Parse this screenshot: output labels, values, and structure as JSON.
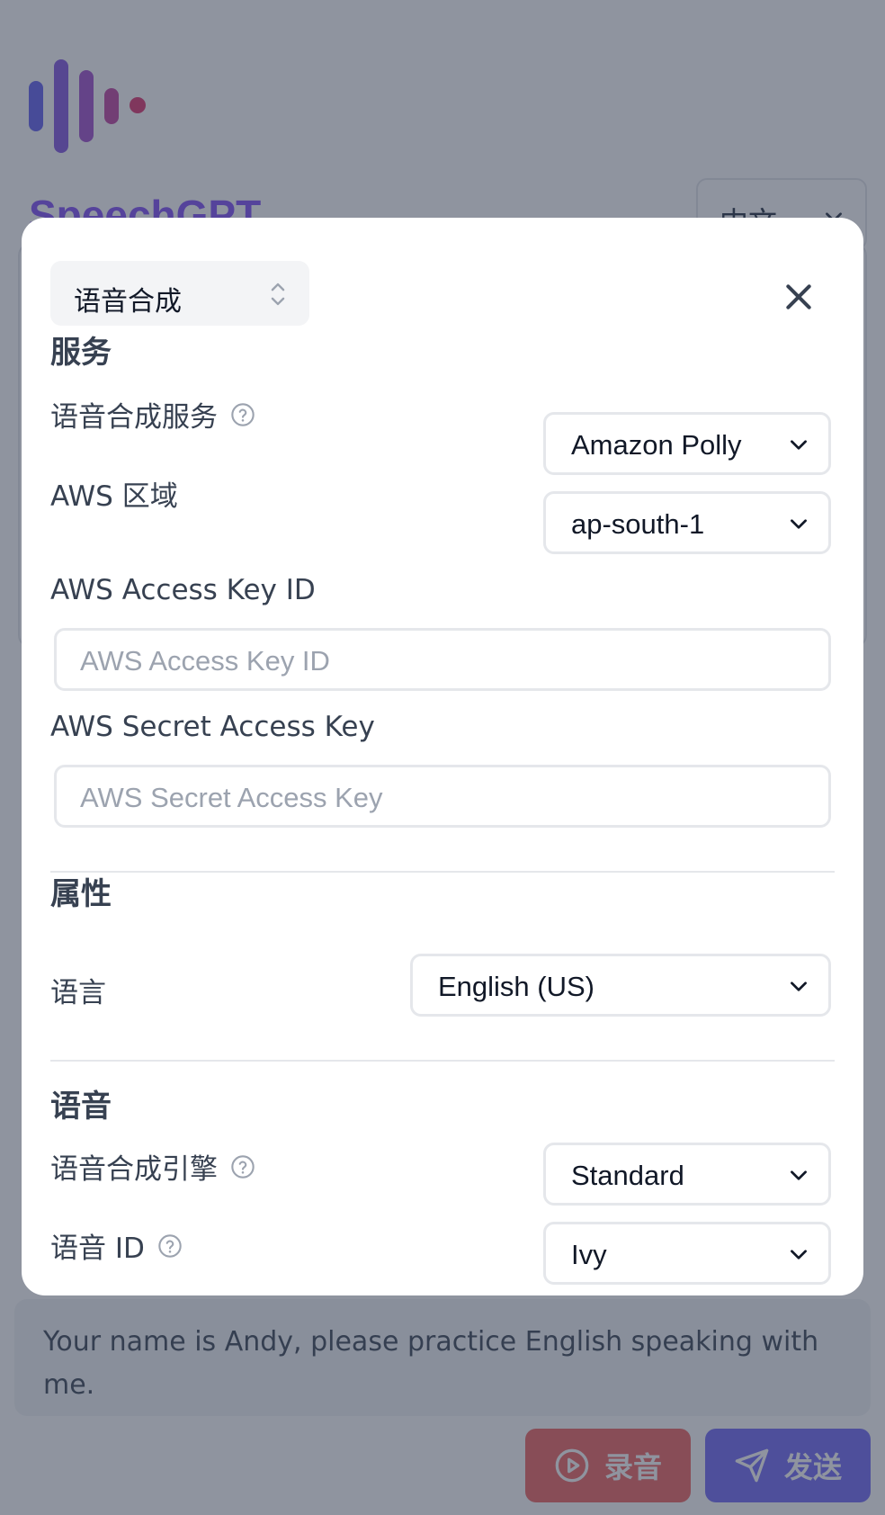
{
  "app": {
    "brand": "SpeechGPT",
    "language_selector": "中文",
    "prompt_text": "Your name is Andy, please practice English speaking with me.",
    "record_label": "录音",
    "send_label": "发送"
  },
  "modal": {
    "section_selector": "语音合成",
    "service": {
      "title": "服务",
      "tts_service_label": "语音合成服务",
      "tts_service_value": "Amazon Polly",
      "aws_region_label": "AWS 区域",
      "aws_region_value": "ap-south-1",
      "access_key_label": "AWS Access Key ID",
      "access_key_placeholder": "AWS Access Key ID",
      "secret_key_label": "AWS Secret Access Key",
      "secret_key_placeholder": "AWS Secret Access Key"
    },
    "properties": {
      "title": "属性",
      "language_label": "语言",
      "language_value": "English (US)"
    },
    "voice": {
      "title": "语音",
      "engine_label": "语音合成引擎",
      "engine_value": "Standard",
      "voice_id_label": "语音 ID",
      "voice_id_value": "Ivy"
    }
  },
  "colors": {
    "logo_gradient_start": "#6f6df0",
    "logo_gradient_end": "#e0457b",
    "record_button": "#f0716f",
    "send_button": "#7c74f7",
    "overlay": "rgba(31,41,64,0.5)"
  }
}
